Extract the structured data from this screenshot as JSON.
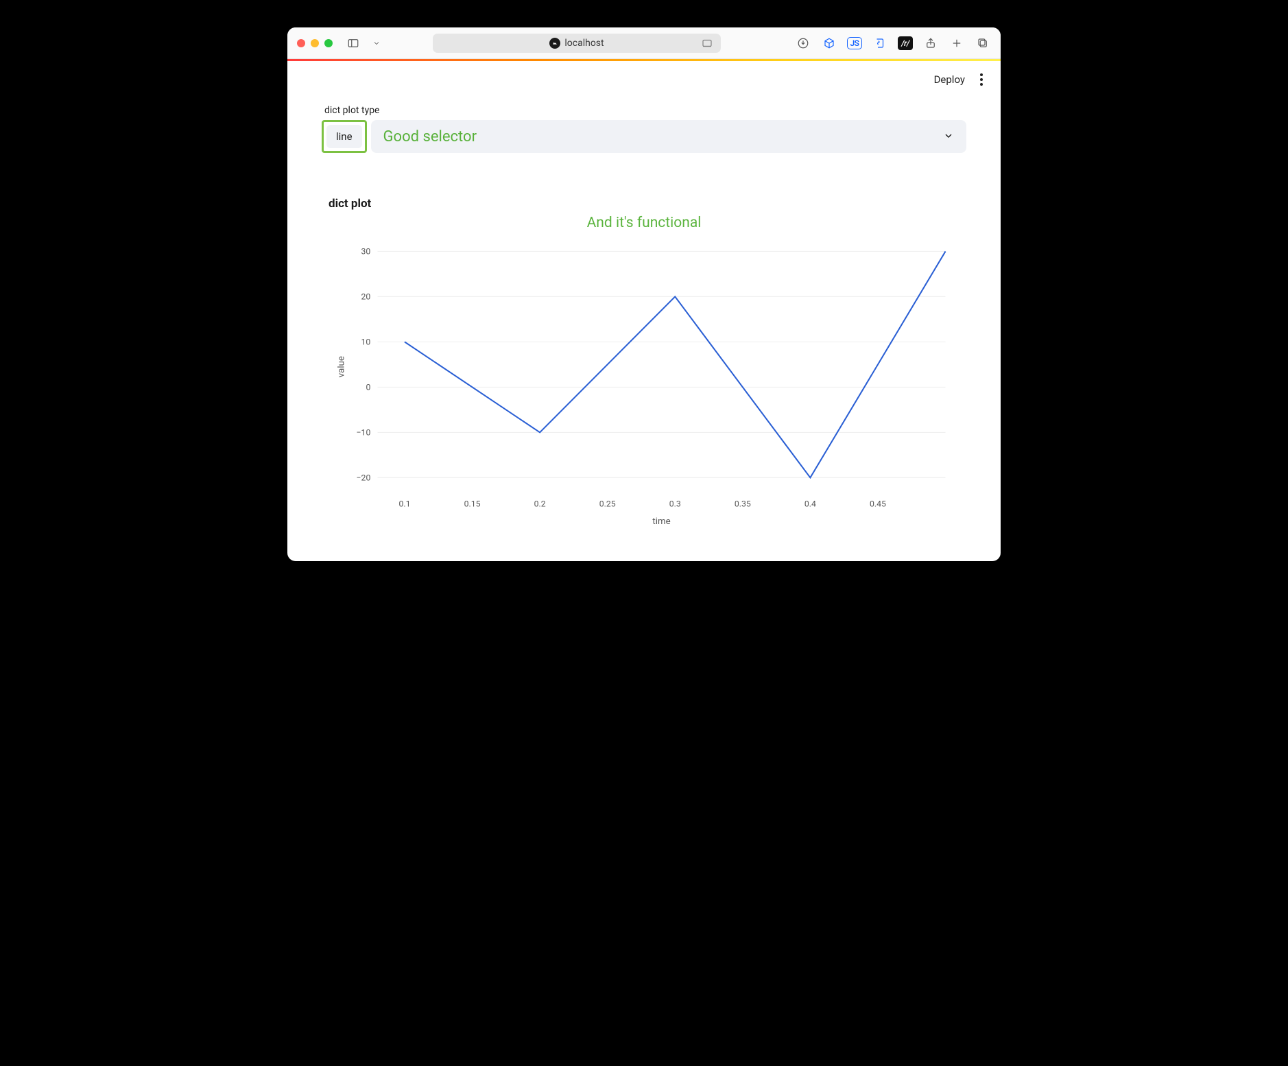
{
  "browser": {
    "address": "localhost",
    "toolbar_icons": [
      "downloads",
      "cube",
      "js",
      "genie",
      "reddit",
      "share",
      "new-tab",
      "tabs"
    ]
  },
  "app": {
    "header": {
      "deploy_label": "Deploy"
    }
  },
  "widget": {
    "label": "dict plot type",
    "selected": "line",
    "annotation": "Good selector"
  },
  "plot": {
    "heading": "dict plot",
    "subtitle": "And it's functional"
  },
  "chart_data": {
    "type": "line",
    "title": "dict plot",
    "xlabel": "time",
    "ylabel": "value",
    "x": [
      0.1,
      0.2,
      0.3,
      0.4,
      0.5
    ],
    "y": [
      10,
      -10,
      20,
      -20,
      30
    ],
    "xticks": [
      0.1,
      0.15,
      0.2,
      0.25,
      0.3,
      0.35,
      0.4,
      0.45
    ],
    "yticks": [
      -20,
      -10,
      0,
      10,
      20,
      30
    ],
    "xlim": [
      0.08,
      0.5
    ],
    "ylim": [
      -23,
      32
    ],
    "line_color": "#2a5fd4"
  }
}
